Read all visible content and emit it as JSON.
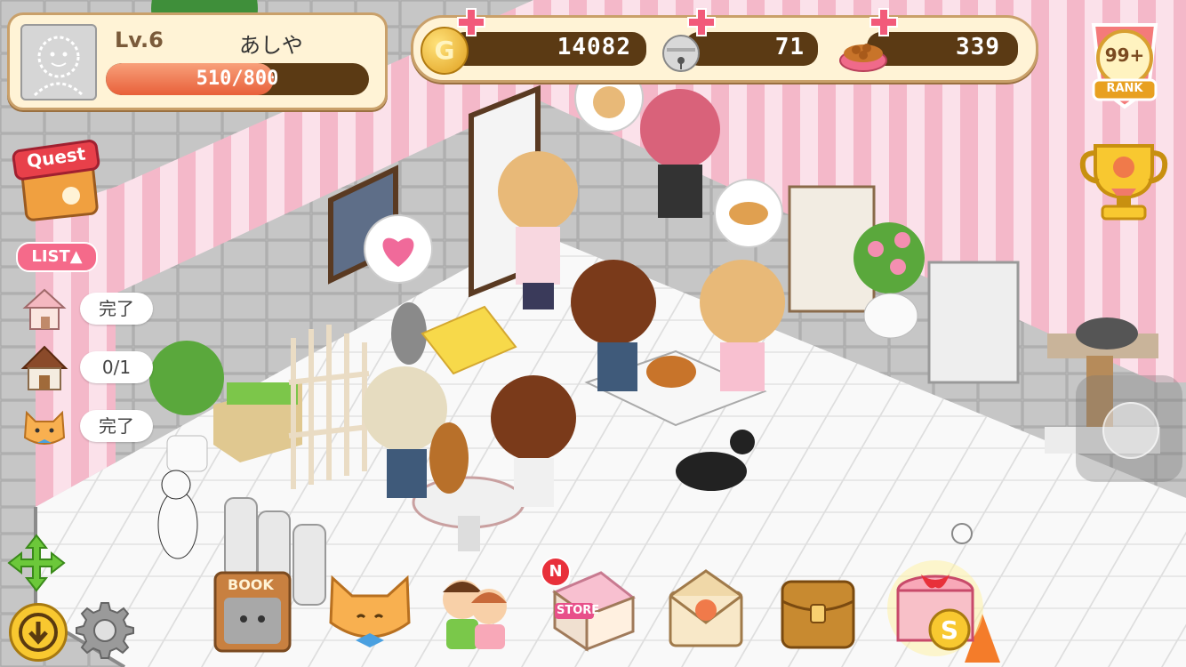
{
  "player": {
    "level": "Lv.6",
    "name": "あしや",
    "exp": "510/800",
    "exp_fraction": 0.6375
  },
  "currencies": [
    {
      "name": "gold-coin-icon",
      "glyph": "G",
      "value": "14082"
    },
    {
      "name": "bell-icon",
      "value": "71"
    },
    {
      "name": "cat-food-icon",
      "value": "339"
    }
  ],
  "rank": {
    "badge": "99+",
    "label": "RANK"
  },
  "quest": {
    "label": "Quest"
  },
  "list": {
    "toggle_label": "LIST▲",
    "tasks": [
      {
        "icon": "house-icon",
        "status": "完了"
      },
      {
        "icon": "cabin-icon",
        "status": "0/1"
      },
      {
        "icon": "cat-face-icon",
        "status": "完了"
      }
    ]
  },
  "bottom_bar": {
    "book_label": "BOOK",
    "store_label": "STORE",
    "store_badge": "N",
    "shop_label": "S"
  },
  "colors": {
    "panel_bg": "#fff3d6",
    "panel_border": "#c9a06a",
    "bar_dark": "#5b3a14",
    "exp_fill": "#f07a4a",
    "wall_pink": "#f7c6d3",
    "floor": "#f4f4f4"
  }
}
